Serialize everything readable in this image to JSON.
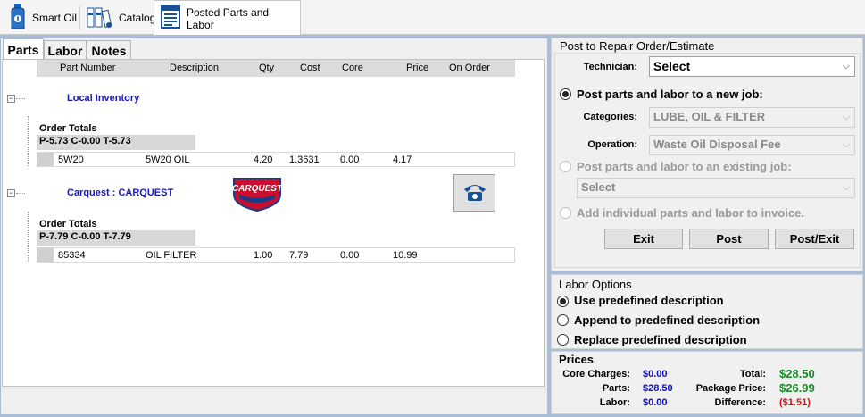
{
  "top_tabs": [
    {
      "label": "Smart Oil",
      "icon": "oil-bottle-icon"
    },
    {
      "label": "Catalog",
      "icon": "catalog-books-icon"
    },
    {
      "label": "Posted Parts and Labor",
      "icon": "document-list-icon"
    }
  ],
  "sub_tabs": [
    "Parts",
    "Labor",
    "Notes"
  ],
  "columns": [
    "Part Number",
    "Description",
    "Qty",
    "Cost",
    "Core",
    "Price",
    "On Order"
  ],
  "groups": [
    {
      "title": "Local Inventory",
      "order_totals_label": "Order Totals",
      "totals": "P-5.73 C-0.00 T-5.73",
      "rows": [
        {
          "part_number": "5W20",
          "description": "5W20 OIL",
          "qty": "4.20",
          "cost": "1.3631",
          "core": "0.00",
          "price": "4.17",
          "on_order": ""
        }
      ]
    },
    {
      "title": "Carquest : CARQUEST",
      "logo_text": "CARQUEST",
      "order_totals_label": "Order Totals",
      "totals": "P-7.79 C-0.00 T-7.79",
      "rows": [
        {
          "part_number": "85334",
          "description": "OIL FILTER",
          "qty": "1.00",
          "cost": "7.79",
          "core": "0.00",
          "price": "10.99",
          "on_order": ""
        }
      ]
    }
  ],
  "post": {
    "title": "Post to Repair Order/Estimate",
    "technician_label": "Technician:",
    "technician_value": "Select",
    "option_new": "Post parts and labor to a new job:",
    "categories_label": "Categories:",
    "categories_value": "LUBE, OIL & FILTER",
    "operation_label": "Operation:",
    "operation_value": "Waste Oil Disposal Fee",
    "option_existing": "Post parts and labor to an existing job:",
    "existing_value": "Select",
    "option_individual": "Add individual parts and labor to invoice.",
    "buttons": [
      "Exit",
      "Post",
      "Post/Exit"
    ]
  },
  "labor_options": {
    "title": "Labor Options",
    "options": [
      "Use predefined description",
      "Append to predefined description",
      "Replace predefined description"
    ],
    "selected": 0
  },
  "prices": {
    "title": "Prices",
    "core_charges_label": "Core Charges:",
    "core_charges": "$0.00",
    "parts_label": "Parts:",
    "parts": "$28.50",
    "labor_label": "Labor:",
    "labor": "$0.00",
    "total_label": "Total:",
    "total": "$28.50",
    "package_price_label": "Package Price:",
    "package_price": "$26.99",
    "difference_label": "Difference:",
    "difference": "($1.51)"
  },
  "colors": {
    "frame": "#a9bdd6",
    "group_title": "#1a1ab8",
    "price_blue": "#1010c0",
    "price_green": "#1a8a2a",
    "difference_red": "#e01010"
  }
}
